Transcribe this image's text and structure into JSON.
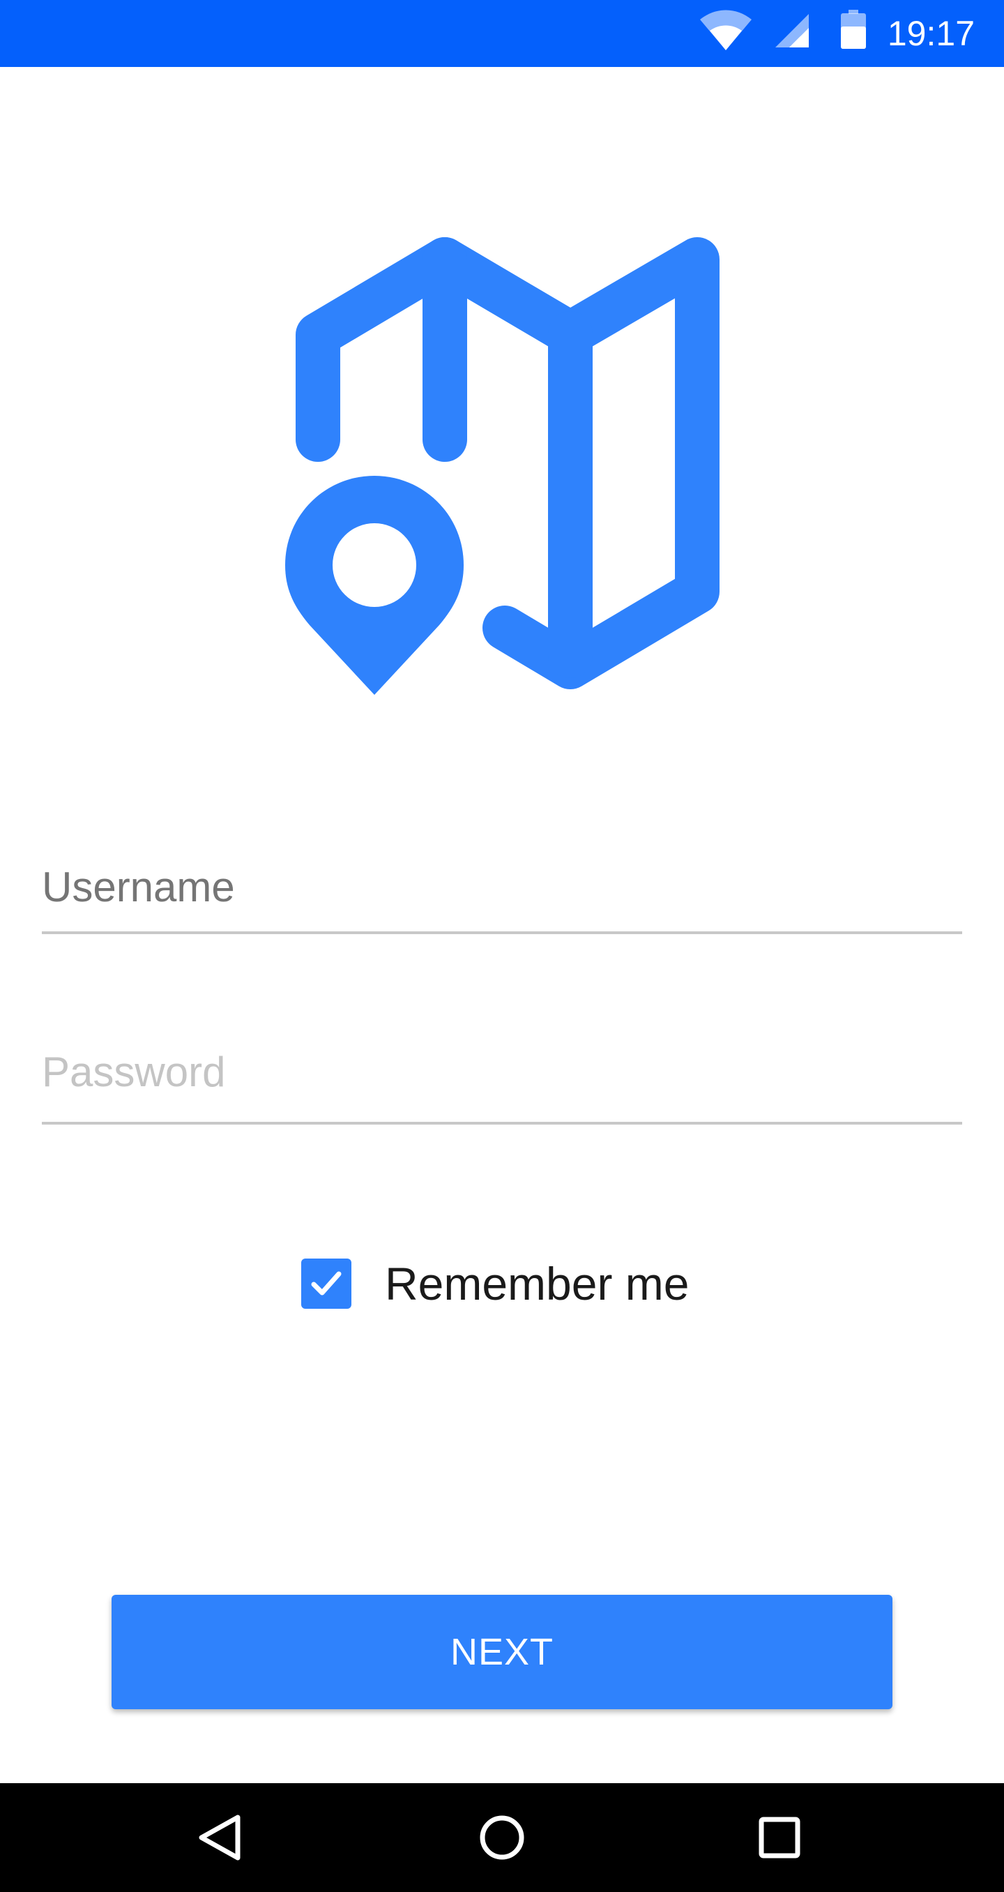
{
  "colors": {
    "status_bar": "#0460fc",
    "accent": "#2f82fc",
    "nav_bar": "#000000"
  },
  "status_bar": {
    "time": "19:17",
    "icons": [
      "wifi-icon",
      "cellular-signal-icon",
      "battery-icon"
    ]
  },
  "logo": {
    "icon": "map-with-location-pin-icon"
  },
  "form": {
    "username_placeholder": "Username",
    "password_placeholder": "Password",
    "remember_label": "Remember me",
    "remember_checked": true
  },
  "actions": {
    "next_label": "NEXT"
  },
  "nav_bar": {
    "icons": [
      "back-icon",
      "home-icon",
      "recents-icon"
    ]
  }
}
